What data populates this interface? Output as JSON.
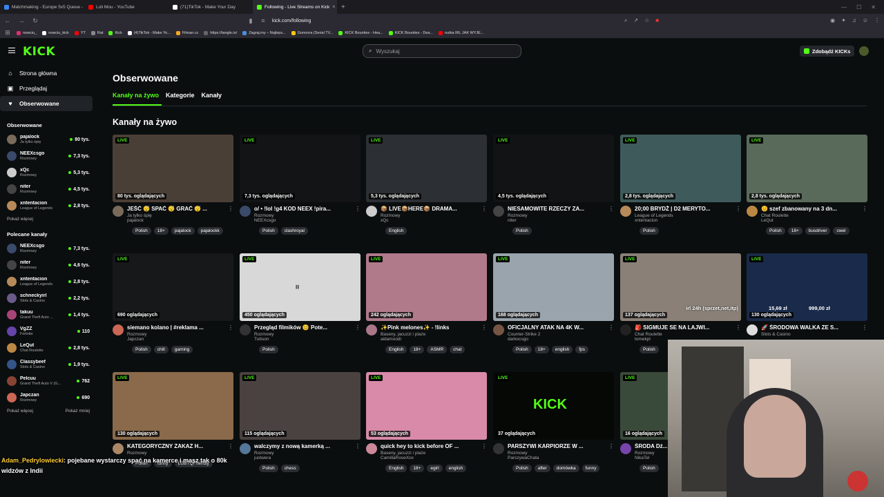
{
  "browser": {
    "tabs": [
      {
        "label": "Matchmaking - Europe 5v5 Queue -",
        "color": "#3b82f6",
        "active": false
      },
      {
        "label": "Loli Mou - YouTube",
        "color": "#ff0000",
        "active": false
      },
      {
        "label": "(71)TikTok - Make Your Day",
        "color": "#ffffff",
        "active": false
      },
      {
        "label": "Following - Live Streams on Kick",
        "color": "#53fc18",
        "active": true
      }
    ],
    "tab_close": "×",
    "new_tab": "+",
    "url": "kick.com/following",
    "bookmarks": [
      {
        "label": "nowciu_",
        "color": "#e1306c"
      },
      {
        "label": "nowciu_kick",
        "color": "#ffffff"
      },
      {
        "label": "YT",
        "color": "#ff0000"
      },
      {
        "label": "Rat",
        "color": "#888888"
      },
      {
        "label": "Kick",
        "color": "#53fc18"
      },
      {
        "label": "(4)TikTok - Make Yo...",
        "color": "#ffffff"
      },
      {
        "label": "Filman.cc",
        "color": "#f5a623"
      },
      {
        "label": "https://tangle.io/",
        "color": "#666666"
      },
      {
        "label": "Zagraj.my – Najleps...",
        "color": "#4a90e2"
      },
      {
        "label": "Gomorra (Serial TV...",
        "color": "#f5c518"
      },
      {
        "label": "KICK Bounties - Hea...",
        "color": "#53fc18"
      },
      {
        "label": "KICK Bounties - Dea...",
        "color": "#53fc18"
      },
      {
        "label": "nutka IRL JAK WYJE...",
        "color": "#ff0000"
      }
    ]
  },
  "header": {
    "logo": "KICK",
    "search_placeholder": "Wyszukaj",
    "kicks_button": "Zdobądź KICKs"
  },
  "sidebar": {
    "nav": [
      {
        "label": "Strona główna",
        "icon": "⌂"
      },
      {
        "label": "Przeglądaj",
        "icon": "▣"
      },
      {
        "label": "Obserwowane",
        "icon": "♥"
      }
    ],
    "followed_title": "Obserwowane",
    "followed": [
      {
        "name": "pajalock",
        "cat": "Ja tylko śpię",
        "viewers": "80 tys.",
        "color": "#7a6a5a"
      },
      {
        "name": "NEEXcsgo",
        "cat": "Rozmowy",
        "viewers": "7,3 tys.",
        "color": "#3a4a6a"
      },
      {
        "name": "xQc",
        "cat": "Rozmowy",
        "viewers": "5,3 tys.",
        "color": "#cccccc"
      },
      {
        "name": "niter",
        "cat": "Rozmowy",
        "viewers": "4,5 tys.",
        "color": "#444444"
      },
      {
        "name": "xntentacion",
        "cat": "League of Legends",
        "viewers": "2,8 tys.",
        "color": "#b78a5a"
      }
    ],
    "show_more": "Pokaż więcej",
    "recommended_title": "Polecane kanały",
    "recommended": [
      {
        "name": "NEEXcsgo",
        "cat": "Rozmowy",
        "viewers": "7,3 tys.",
        "color": "#3a4a6a"
      },
      {
        "name": "niter",
        "cat": "Rozmowy",
        "viewers": "4,6 tys.",
        "color": "#444444"
      },
      {
        "name": "xntentacion",
        "cat": "League of Legends",
        "viewers": "2,8 tys.",
        "color": "#b78a5a"
      },
      {
        "name": "schneckyirl",
        "cat": "Slots & Casino",
        "viewers": "2,2 tys.",
        "color": "#6a5a8a"
      },
      {
        "name": "takuu",
        "cat": "Grand Theft Auto ...",
        "viewers": "1,4 tys.",
        "color": "#aa4477"
      },
      {
        "name": "VgZZ",
        "cat": "Fortnite",
        "viewers": "110",
        "color": "#6644aa"
      },
      {
        "name": "LeQut",
        "cat": "Chat Roulette",
        "viewers": "2,8 tys.",
        "color": "#bb8844"
      },
      {
        "name": "Classybeef",
        "cat": "Slots & Casino",
        "viewers": "1,9 tys.",
        "color": "#335588"
      },
      {
        "name": "Pelcuu",
        "cat": "Grand Theft Auto V (G...",
        "viewers": "762",
        "color": "#884433"
      },
      {
        "name": "Japczan",
        "cat": "Rozmowy",
        "viewers": "690",
        "color": "#cc6655"
      }
    ],
    "show_more2": "Pokaż więcej",
    "show_less": "Pokaż mniej"
  },
  "main": {
    "title": "Obserwowane",
    "tabs": [
      "Kanały na żywo",
      "Kategorie",
      "Kanały"
    ],
    "section_title": "Kanały na żywo",
    "live_badge": "LIVE",
    "menu_dots": "⋮",
    "cards": [
      {
        "viewers": "80 tys. oglądających",
        "title": "JEŚĆ 😴 SPAĆ 😴 GRAĆ 😴 ...",
        "cat": "Ja tylko śpię",
        "chan": "pajalock",
        "tags": [
          "Polish",
          "18+",
          "pajalock",
          "pajalockk"
        ],
        "bg": "#4a3f36",
        "av": "#7a6a5a"
      },
      {
        "viewers": "7,3 tys. oglądających",
        "title": "o/ • !lol !g4 KOD NEEX !pira...",
        "cat": "Rozmowy",
        "chan": "NEEXcsgo",
        "tags": [
          "Polish",
          "clashroyal"
        ],
        "bg": "#121416",
        "av": "#3a4a6a"
      },
      {
        "viewers": "5,3 tys. oglądających",
        "title": "📦 LIVE📦HERE📦 DRAMA...",
        "cat": "Rozmowy",
        "chan": "xQc",
        "tags": [
          "English"
        ],
        "bg": "#2c2f33",
        "av": "#cccccc"
      },
      {
        "viewers": "4,5 tys. oglądających",
        "title": "NIESAMOWITE RZECZY ZA...",
        "cat": "Rozmowy",
        "chan": "niter",
        "tags": [
          "Polish"
        ],
        "bg": "#111315",
        "av": "#444444"
      },
      {
        "viewers": "2,8 tys. oglądających",
        "title": "20;00 BRYDŻ | D2 MERYTO...",
        "cat": "League of Legends",
        "chan": "xntentacion",
        "tags": [
          "Polish"
        ],
        "bg": "#3f5a5a",
        "av": "#b78a5a"
      },
      {
        "viewers": "2,8 tys. oglądających",
        "title": "😊 szef zbanowany na 3 dn...",
        "cat": "Chat Roulette",
        "chan": "LeQut",
        "tags": [
          "Polish",
          "18+",
          "busdriver",
          "cwel"
        ],
        "bg": "#5a6a5a",
        "av": "#bb8844"
      },
      {
        "viewers": "690 oglądających",
        "title": "siemano kolano | #reklama ...",
        "cat": "Rozmowy",
        "chan": "Japczan",
        "tags": [
          "Polish",
          "chill",
          "gaming"
        ],
        "bg": "#161819",
        "av": "#cc6655"
      },
      {
        "viewers": "450 oglądających",
        "title": "Przegląd filmików 😊 Pote...",
        "cat": "Rozmowy",
        "chan": "Tubson",
        "tags": [
          "Polish"
        ],
        "bg": "#d8d8d8",
        "av": "#333333"
      },
      {
        "viewers": "242 oglądających",
        "title": "✨Pink melones✨ - !links",
        "cat": "Baseny, jacuzzi i plaże",
        "chan": "aidamoodi",
        "tags": [
          "English",
          "18+",
          "ASMR",
          "chat"
        ],
        "bg": "#b07a8a",
        "av": "#aa7788"
      },
      {
        "viewers": "168 oglądających",
        "title": "OFICJALNY ATAK NA 4K W...",
        "cat": "Counter-Strike 2",
        "chan": "darkocsgo",
        "tags": [
          "Polish",
          "18+",
          "english",
          "fps"
        ],
        "bg": "#9aa4ad",
        "av": "#775544"
      },
      {
        "viewers": "137 oglądających",
        "title": "🎒 SIGMUJE SE NA LAJWI...",
        "cat": "Chat Roulette",
        "chan": "tomekpl",
        "tags": [
          "Polish"
        ],
        "bg": "#8a8078",
        "av": "#222222"
      },
      {
        "viewers": "130 oglądających",
        "title": "🚀 ŚRODOWA WALKA ZE S...",
        "cat": "Slots & Casino",
        "chan": "",
        "tags": [],
        "bg": "#1a2a4a",
        "av": "#dddddd"
      },
      {
        "viewers": "130 oglądających",
        "title": "KATEGORYCZNY ZAKAZ H...",
        "cat": "Rozmowy",
        "chan": "",
        "tags": [
          "Polish",
          "funny",
          "LGBTQFriendly"
        ],
        "bg": "#8a6a4a",
        "av": "#aa8866"
      },
      {
        "viewers": "115 oglądających",
        "title": "walczymy z nową kamerką ...",
        "cat": "Rozmowy",
        "chan": "justwera",
        "tags": [
          "Polish",
          "chess"
        ],
        "bg": "#4a4240",
        "av": "#557799"
      },
      {
        "viewers": "53 oglądających",
        "title": "quick hey to kick before OF ...",
        "cat": "Baseny, jacuzzi i plaże",
        "chan": "CamillaRoseXox",
        "tags": [
          "English",
          "18+",
          "egirl",
          "english"
        ],
        "bg": "#d88aa8",
        "av": "#cc8899"
      },
      {
        "viewers": "37 oglądających",
        "title": "PARSZYWI KARPIORZE W ...",
        "cat": "Rozmowy",
        "chan": "ParszywaChata",
        "tags": [
          "Polish",
          "after",
          "domówka",
          "funny"
        ],
        "bg": "#050805",
        "av": "#333333"
      },
      {
        "viewers": "16 oglądających",
        "title": "ŚRODA Dź...",
        "cat": "Rozmowy",
        "chan": "NikaTel",
        "tags": [
          "Polish"
        ],
        "bg": "#3a4a3a",
        "av": "#7744aa"
      }
    ],
    "kick_thumb_logo": "KICK",
    "overlay_texts": [
      "irl 24h (sprzet,net,itp)",
      "15,69 zł",
      "999,00 zł"
    ]
  },
  "chat_overlay": {
    "user": "Adam_Pedrylowiecki",
    "line1": ": pojebane wystarczy spać na kamerce i masz tak o 80k",
    "line2": "widzów z Indii"
  },
  "colors": {
    "accent": "#53fc18",
    "bg": "#0b0e0f"
  }
}
